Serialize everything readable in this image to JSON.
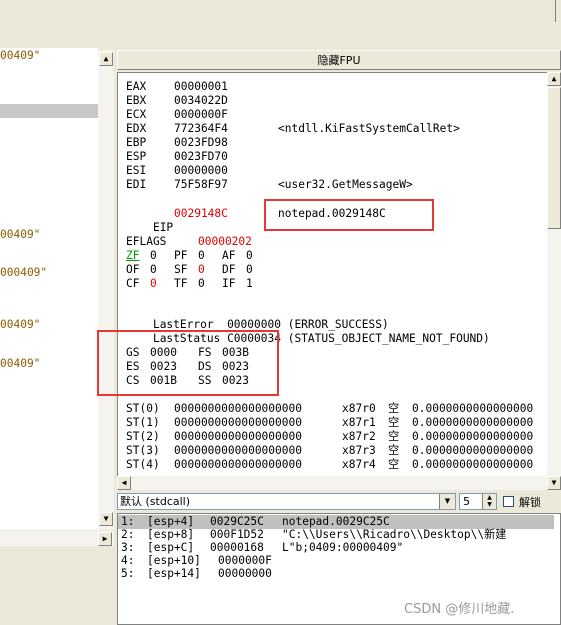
{
  "fpu_header": "隐藏FPU",
  "left_pane": {
    "snippets": [
      "00409\"",
      "00409\"",
      "000409\"",
      "00409\"",
      "00409\""
    ]
  },
  "registers": [
    {
      "name": "EAX",
      "value": "00000001",
      "comment": ""
    },
    {
      "name": "EBX",
      "value": "0034022D",
      "comment": ""
    },
    {
      "name": "ECX",
      "value": "0000000F",
      "comment": ""
    },
    {
      "name": "EDX",
      "value": "772364F4",
      "comment": "<ntdll.KiFastSystemCallRet>"
    },
    {
      "name": "EBP",
      "value": "0023FD98",
      "comment": ""
    },
    {
      "name": "ESP",
      "value": "0023FD70",
      "comment": ""
    },
    {
      "name": "ESI",
      "value": "00000000",
      "comment": ""
    },
    {
      "name": "EDI",
      "value": "75F58F97",
      "comment": "<user32.GetMessageW>"
    }
  ],
  "eip": {
    "name": "EIP",
    "value": "0029148C",
    "comment": "notepad.0029148C"
  },
  "eflags": {
    "name": "EFLAGS",
    "value": "00000202"
  },
  "flags_rows": [
    [
      {
        "n": "ZF",
        "v": "0"
      },
      {
        "n": "PF",
        "v": "0"
      },
      {
        "n": "AF",
        "v": "0"
      }
    ],
    [
      {
        "n": "OF",
        "v": "0"
      },
      {
        "n": "SF",
        "v": "0"
      },
      {
        "n": "DF",
        "v": "0"
      }
    ],
    [
      {
        "n": "CF",
        "v": "0"
      },
      {
        "n": "TF",
        "v": "0"
      },
      {
        "n": "IF",
        "v": "1"
      }
    ]
  ],
  "last_error": {
    "label": "LastError",
    "value": "00000000",
    "desc": "(ERROR_SUCCESS)"
  },
  "last_status": {
    "label": "LastStatus",
    "value": "C0000034",
    "desc": "(STATUS_OBJECT_NAME_NOT_FOUND)"
  },
  "segments": [
    [
      {
        "n": "GS",
        "v": "0000"
      },
      {
        "n": "FS",
        "v": "003B"
      }
    ],
    [
      {
        "n": "ES",
        "v": "0023"
      },
      {
        "n": "DS",
        "v": "0023"
      }
    ],
    [
      {
        "n": "CS",
        "v": "001B"
      },
      {
        "n": "SS",
        "v": "0023"
      }
    ]
  ],
  "fpu": [
    {
      "name": "ST(0)",
      "value": "0000000000000000000",
      "tag": "x87r0",
      "status": "空",
      "float": "0.0000000000000000"
    },
    {
      "name": "ST(1)",
      "value": "0000000000000000000",
      "tag": "x87r1",
      "status": "空",
      "float": "0.0000000000000000"
    },
    {
      "name": "ST(2)",
      "value": "0000000000000000000",
      "tag": "x87r2",
      "status": "空",
      "float": "0.0000000000000000"
    },
    {
      "name": "ST(3)",
      "value": "0000000000000000000",
      "tag": "x87r3",
      "status": "空",
      "float": "0.0000000000000000"
    },
    {
      "name": "ST(4)",
      "value": "0000000000000000000",
      "tag": "x87r4",
      "status": "空",
      "float": "0.0000000000000000"
    }
  ],
  "callconv": {
    "selected": "默认 (stdcall)",
    "count": "5",
    "decode_label": "解锁"
  },
  "stack_args": [
    {
      "idx": "1:",
      "ref": "[esp+4]",
      "value": "0029C25C",
      "comment": "notepad.0029C25C"
    },
    {
      "idx": "2:",
      "ref": "[esp+8]",
      "value": "000F1D52",
      "comment": "\"C:\\\\Users\\\\Ricadro\\\\Desktop\\\\新建"
    },
    {
      "idx": "3:",
      "ref": "[esp+C]",
      "value": "00000168",
      "comment": "L\"b;0409:00000409\""
    },
    {
      "idx": "4:",
      "ref": "[esp+10]",
      "value": "0000000F",
      "comment": ""
    },
    {
      "idx": "5:",
      "ref": "[esp+14]",
      "value": "00000000",
      "comment": ""
    }
  ],
  "watermark": "CSDN @修川地藏."
}
